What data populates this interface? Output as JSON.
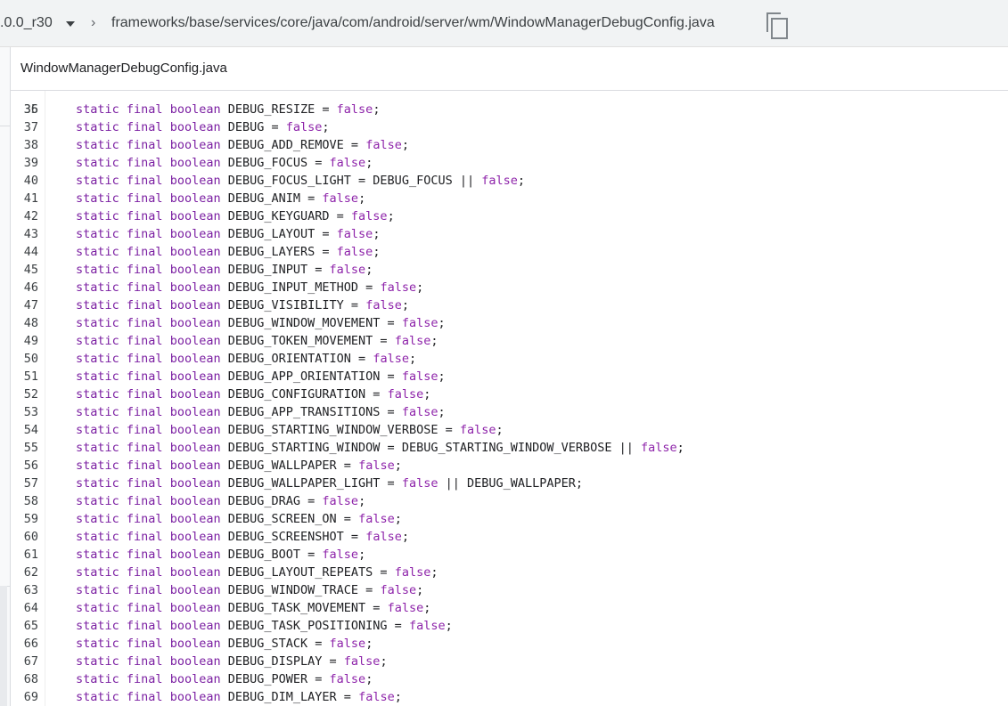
{
  "header": {
    "branch": ".0.0_r30",
    "path": "frameworks/base/services/core/java/com/android/server/wm/WindowManagerDebugConfig.java"
  },
  "file": {
    "name": "WindowManagerDebugConfig.java"
  },
  "partial_line_number": "35",
  "keywords": {
    "static": "static",
    "final": "final",
    "boolean": "boolean",
    "false": "false"
  },
  "lines": [
    {
      "n": "36",
      "pre": "DEBUG_RESIZE = ",
      "post": ";"
    },
    {
      "n": "37",
      "pre": "DEBUG = ",
      "post": ";"
    },
    {
      "n": "38",
      "pre": "DEBUG_ADD_REMOVE = ",
      "post": ";"
    },
    {
      "n": "39",
      "pre": "DEBUG_FOCUS = ",
      "post": ";"
    },
    {
      "n": "40",
      "pre": "DEBUG_FOCUS_LIGHT = DEBUG_FOCUS || ",
      "post": ";"
    },
    {
      "n": "41",
      "pre": "DEBUG_ANIM = ",
      "post": ";"
    },
    {
      "n": "42",
      "pre": "DEBUG_KEYGUARD = ",
      "post": ";"
    },
    {
      "n": "43",
      "pre": "DEBUG_LAYOUT = ",
      "post": ";"
    },
    {
      "n": "44",
      "pre": "DEBUG_LAYERS = ",
      "post": ";"
    },
    {
      "n": "45",
      "pre": "DEBUG_INPUT = ",
      "post": ";"
    },
    {
      "n": "46",
      "pre": "DEBUG_INPUT_METHOD = ",
      "post": ";"
    },
    {
      "n": "47",
      "pre": "DEBUG_VISIBILITY = ",
      "post": ";"
    },
    {
      "n": "48",
      "pre": "DEBUG_WINDOW_MOVEMENT = ",
      "post": ";"
    },
    {
      "n": "49",
      "pre": "DEBUG_TOKEN_MOVEMENT = ",
      "post": ";"
    },
    {
      "n": "50",
      "pre": "DEBUG_ORIENTATION = ",
      "post": ";"
    },
    {
      "n": "51",
      "pre": "DEBUG_APP_ORIENTATION = ",
      "post": ";"
    },
    {
      "n": "52",
      "pre": "DEBUG_CONFIGURATION = ",
      "post": ";"
    },
    {
      "n": "53",
      "pre": "DEBUG_APP_TRANSITIONS = ",
      "post": ";"
    },
    {
      "n": "54",
      "pre": "DEBUG_STARTING_WINDOW_VERBOSE = ",
      "post": ";"
    },
    {
      "n": "55",
      "pre": "DEBUG_STARTING_WINDOW = DEBUG_STARTING_WINDOW_VERBOSE || ",
      "post": ";"
    },
    {
      "n": "56",
      "pre": "DEBUG_WALLPAPER = ",
      "post": ";"
    },
    {
      "n": "57",
      "pre": "DEBUG_WALLPAPER_LIGHT = ",
      "post": " || DEBUG_WALLPAPER;"
    },
    {
      "n": "58",
      "pre": "DEBUG_DRAG = ",
      "post": ";"
    },
    {
      "n": "59",
      "pre": "DEBUG_SCREEN_ON = ",
      "post": ";"
    },
    {
      "n": "60",
      "pre": "DEBUG_SCREENSHOT = ",
      "post": ";"
    },
    {
      "n": "61",
      "pre": "DEBUG_BOOT = ",
      "post": ";"
    },
    {
      "n": "62",
      "pre": "DEBUG_LAYOUT_REPEATS = ",
      "post": ";"
    },
    {
      "n": "63",
      "pre": "DEBUG_WINDOW_TRACE = ",
      "post": ";"
    },
    {
      "n": "64",
      "pre": "DEBUG_TASK_MOVEMENT = ",
      "post": ";"
    },
    {
      "n": "65",
      "pre": "DEBUG_TASK_POSITIONING = ",
      "post": ";"
    },
    {
      "n": "66",
      "pre": "DEBUG_STACK = ",
      "post": ";"
    },
    {
      "n": "67",
      "pre": "DEBUG_DISPLAY = ",
      "post": ";"
    },
    {
      "n": "68",
      "pre": "DEBUG_POWER = ",
      "post": ";"
    },
    {
      "n": "69",
      "pre": "DEBUG_DIM_LAYER = ",
      "post": ";"
    }
  ]
}
